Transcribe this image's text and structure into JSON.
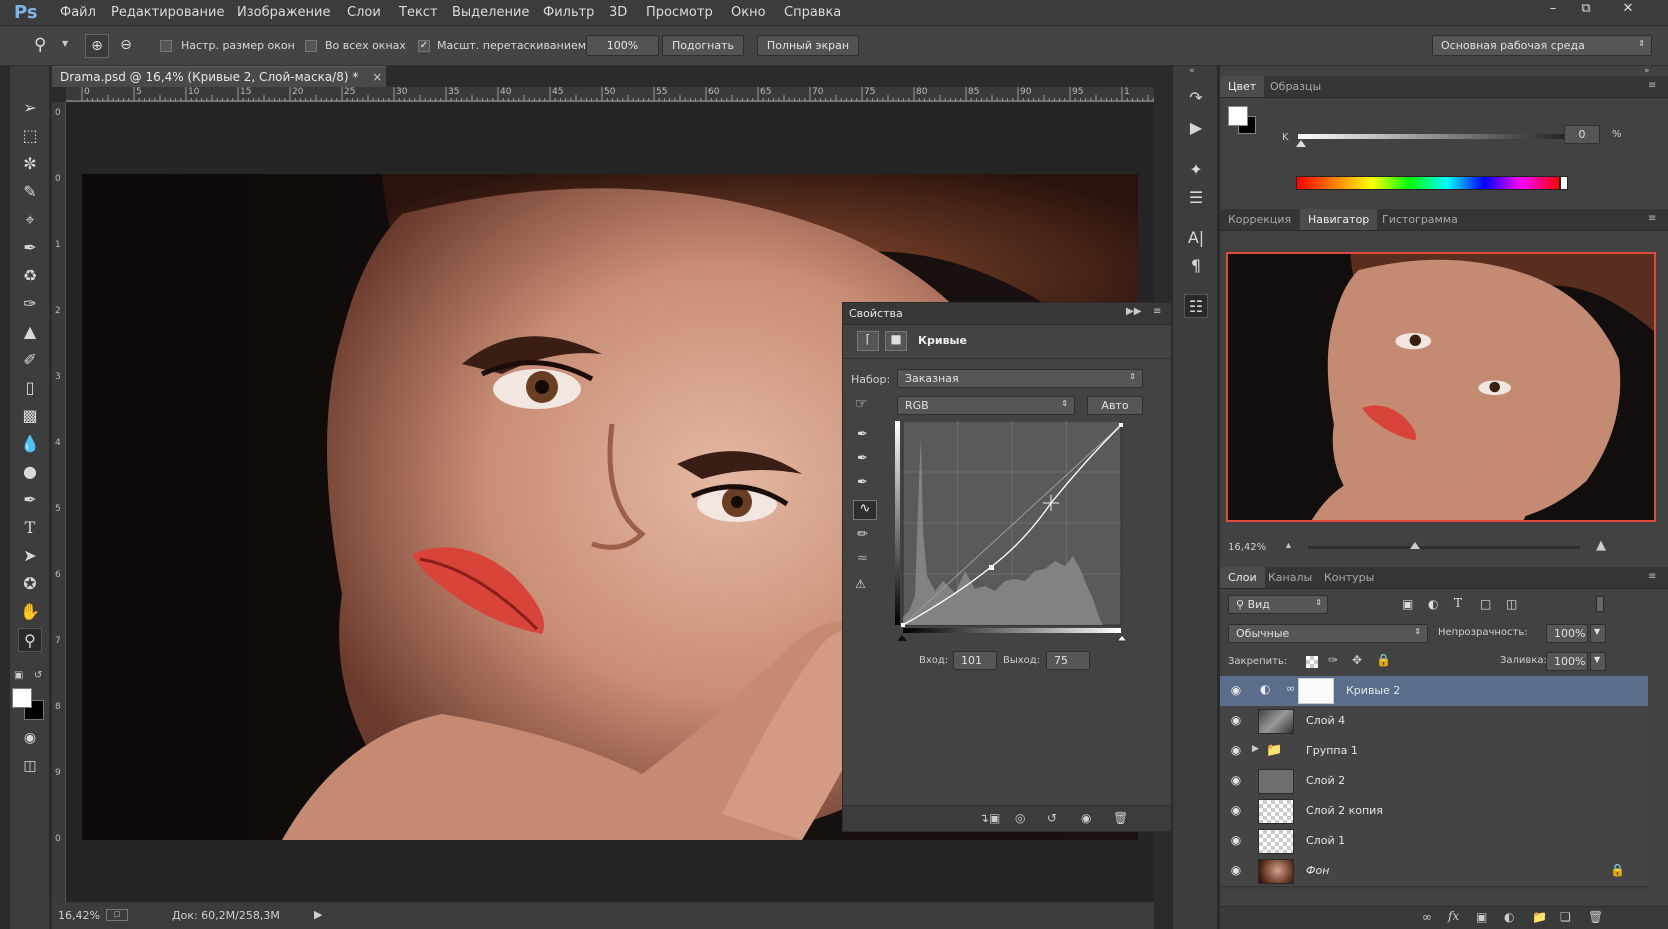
{
  "app": {
    "logo": "Ps"
  },
  "menu": [
    "Файл",
    "Редактирование",
    "Изображение",
    "Слои",
    "Текст",
    "Выделение",
    "Фильтр",
    "3D",
    "Просмотр",
    "Окно",
    "Справка"
  ],
  "options": {
    "resize_windows": "Настр. размер окон",
    "all_windows": "Во всех окнах",
    "scrubby_zoom": "Масшт. перетаскиванием",
    "zoom_100": "100%",
    "fit": "Подогнать",
    "fullscreen": "Полный экран",
    "workspace": "Основная рабочая среда",
    "checked": {
      "resize_windows": false,
      "all_windows": false,
      "scrubby_zoom": true
    }
  },
  "document": {
    "tab_title": "Drama.psd @ 16,4% (Кривые 2, Слой-маска/8) *",
    "close": "×",
    "ruler_h": [
      "0",
      "5",
      "10",
      "15",
      "20",
      "25",
      "30",
      "35",
      "40",
      "45",
      "50",
      "55",
      "60",
      "65",
      "70",
      "75",
      "80",
      "85",
      "90",
      "95",
      "1"
    ],
    "ruler_v": [
      "0",
      "0",
      "1",
      "2",
      "3",
      "4",
      "5",
      "6",
      "7",
      "8",
      "9",
      "0"
    ]
  },
  "status": {
    "zoom": "16,42%",
    "doc": "Док: 60,2M/258,3M"
  },
  "properties": {
    "title": "Свойства",
    "panel_name": "Кривые",
    "preset_label": "Набор:",
    "preset_value": "Заказная",
    "channel": "RGB",
    "auto": "Авто",
    "input_label": "Вход:",
    "input_value": "101",
    "output_label": "Выход:",
    "output_value": "75"
  },
  "color_panel": {
    "tabs": [
      "Цвет",
      "Образцы"
    ],
    "active_tab": "Цвет",
    "k_label": "K",
    "k_value": "0",
    "percent": "%"
  },
  "navigator": {
    "tabs": [
      "Коррекция",
      "Навигатор",
      "Гистограмма"
    ],
    "active_tab": "Навигатор",
    "zoom": "16,42%"
  },
  "layers": {
    "tabs": [
      "Слои",
      "Каналы",
      "Контуры"
    ],
    "active_tab": "Слои",
    "filter": "Вид",
    "blend_mode": "Обычные",
    "opacity_label": "Непрозрачность:",
    "opacity": "100%",
    "lock_label": "Закрепить:",
    "fill_label": "Заливка:",
    "fill": "100%",
    "items": [
      {
        "name": "Кривые 2",
        "kind": "adjustment",
        "selected": true
      },
      {
        "name": "Слой 4",
        "kind": "photo-bw"
      },
      {
        "name": "Группа 1",
        "kind": "group"
      },
      {
        "name": "Слой 2",
        "kind": "gray"
      },
      {
        "name": "Слой 2 копия",
        "kind": "transparent"
      },
      {
        "name": "Слой 1",
        "kind": "transparent"
      },
      {
        "name": "Фон",
        "kind": "photo",
        "locked": true
      }
    ]
  },
  "colors": {
    "accent_selection": "#5a6e8c",
    "navigator_box": "#e04a3a"
  }
}
